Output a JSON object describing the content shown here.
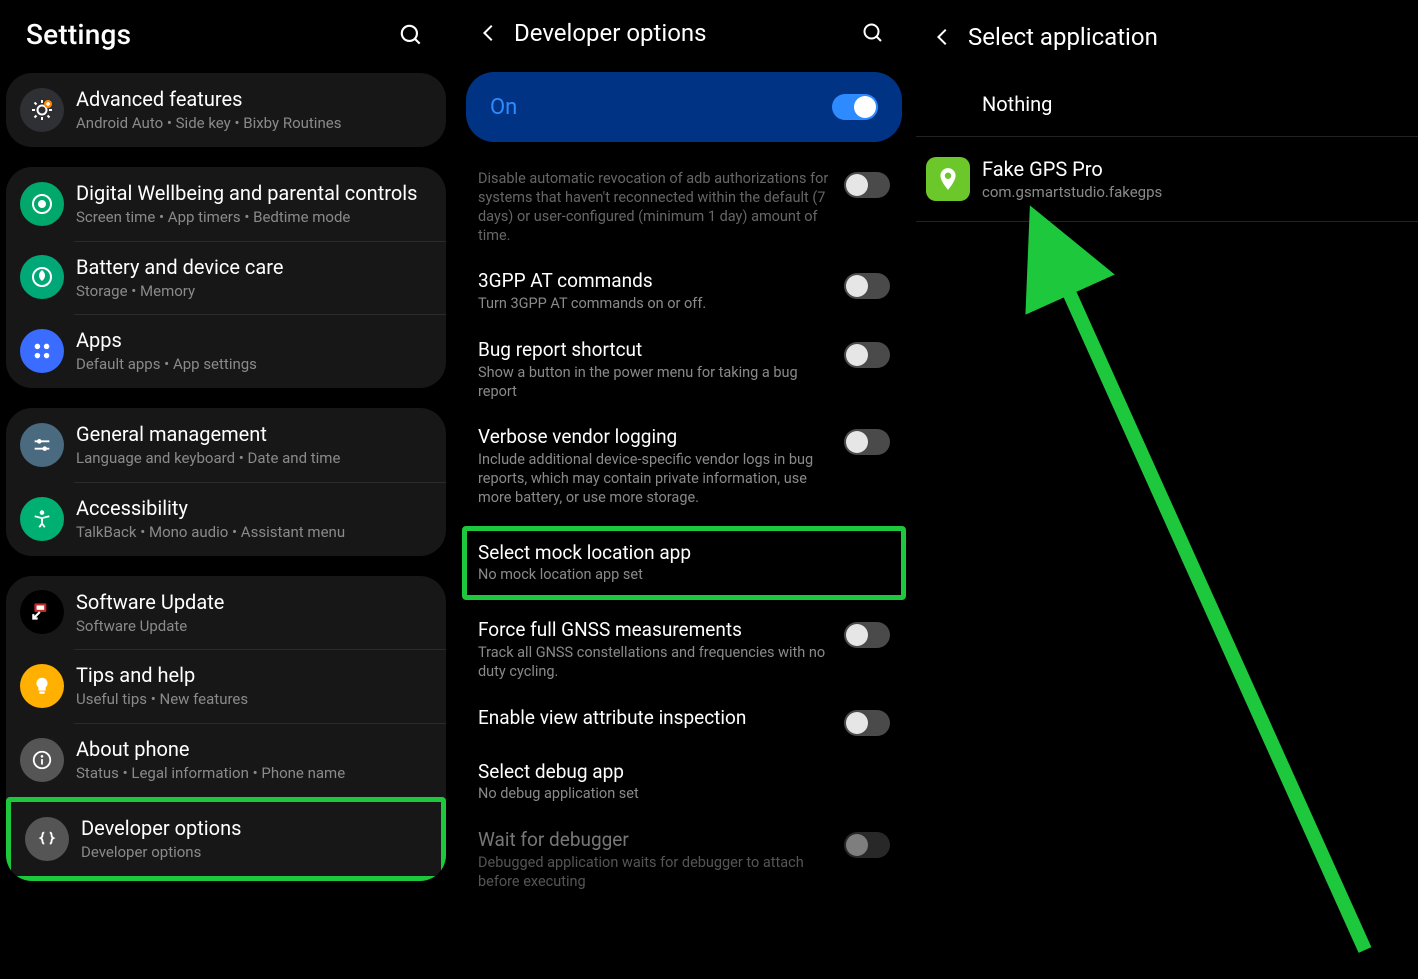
{
  "col1": {
    "title": "Settings",
    "groups": [
      [
        {
          "icon": "gear-plus",
          "bg": "#2f3033",
          "t": "Advanced features",
          "s": "Android Auto  •  Side key  •  Bixby Routines"
        }
      ],
      [
        {
          "icon": "wellbeing",
          "bg": "#00a86b",
          "t": "Digital Wellbeing and parental controls",
          "s": "Screen time  •  App timers  •  Bedtime mode"
        },
        {
          "icon": "battery",
          "bg": "#00a878",
          "t": "Battery and device care",
          "s": "Storage  •  Memory"
        },
        {
          "icon": "apps",
          "bg": "#3a6cff",
          "t": "Apps",
          "s": "Default apps  •  App settings"
        }
      ],
      [
        {
          "icon": "sliders",
          "bg": "#4a6a80",
          "t": "General management",
          "s": "Language and keyboard  •  Date and time"
        },
        {
          "icon": "accessibility",
          "bg": "#00b073",
          "t": "Accessibility",
          "s": "TalkBack  •  Mono audio  •  Assistant menu"
        }
      ],
      [
        {
          "icon": "update",
          "bg": "#000",
          "t": "Software Update",
          "s": "Software Update"
        },
        {
          "icon": "bulb",
          "bg": "#ffb000",
          "t": "Tips and help",
          "s": "Useful tips  •  New features"
        },
        {
          "icon": "info",
          "bg": "#555",
          "t": "About phone",
          "s": "Status  •  Legal information  •  Phone name"
        },
        {
          "icon": "braces",
          "bg": "#555",
          "t": "Developer options",
          "s": "Developer options",
          "hl": true
        }
      ]
    ]
  },
  "col2": {
    "title": "Developer options",
    "on_label": "On",
    "items": [
      {
        "cutoff": true,
        "s": "Disable automatic revocation of adb authorizations for systems that haven't reconnected within the default (7 days) or user-configured (minimum 1 day) amount of time.",
        "toggle": "off"
      },
      {
        "t": "3GPP AT commands",
        "s": "Turn 3GPP AT commands on or off.",
        "toggle": "off"
      },
      {
        "t": "Bug report shortcut",
        "s": "Show a button in the power menu for taking a bug report",
        "toggle": "off"
      },
      {
        "t": "Verbose vendor logging",
        "s": "Include additional device-specific vendor logs in bug reports, which may contain private information, use more battery, or use more storage.",
        "toggle": "off"
      },
      {
        "t": "Select mock location app",
        "s": "No mock location app set",
        "hl": true
      },
      {
        "t": "Force full GNSS measurements",
        "s": "Track all GNSS constellations and frequencies with no duty cycling.",
        "toggle": "off"
      },
      {
        "t": "Enable view attribute inspection",
        "toggle": "off"
      },
      {
        "t": "Select debug app",
        "s": "No debug application set"
      },
      {
        "t": "Wait for debugger",
        "s": "Debugged application waits for debugger to attach before executing",
        "toggle": "off",
        "dim": true
      }
    ]
  },
  "col3": {
    "title": "Select application",
    "items": [
      {
        "t": "Nothing"
      },
      {
        "t": "Fake GPS Pro",
        "s": "com.gsmartstudio.fakegps",
        "icon": "pin",
        "bg": "#6cc72b"
      }
    ]
  }
}
